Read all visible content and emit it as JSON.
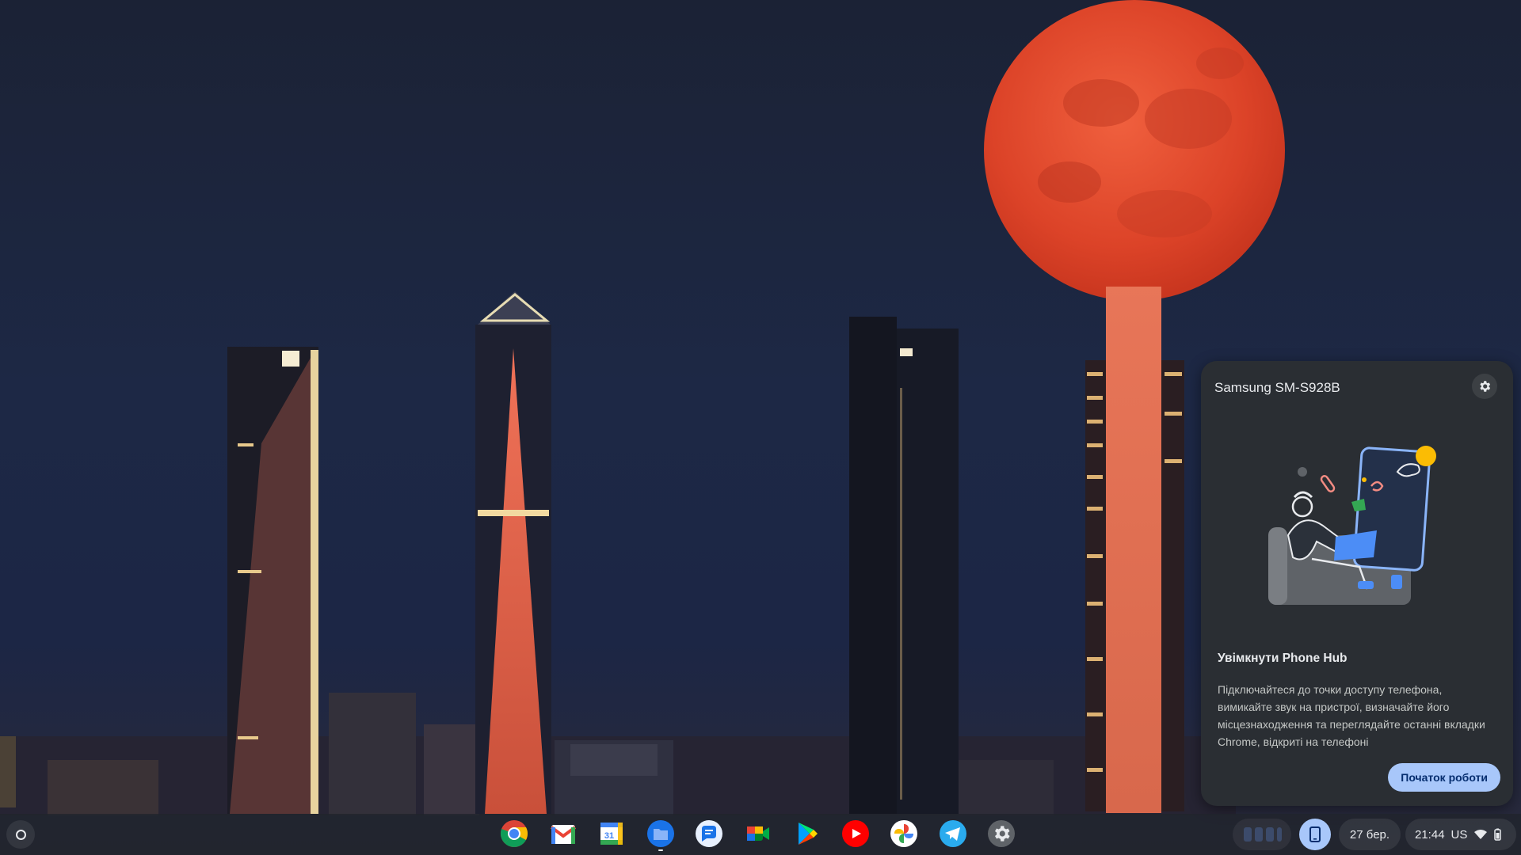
{
  "phone_hub": {
    "device_name": "Samsung SM-S928B",
    "heading": "Увімкнути Phone Hub",
    "description": "Підключайтеся до точки доступу телефона, вимикайте звук на пристрої, визначайте його місцезнаходження та переглядайте останні вкладки Chrome, відкриті на телефоні",
    "start_button": "Початок роботи",
    "settings_icon": "gear-icon"
  },
  "shelf": {
    "apps": [
      {
        "name": "Chrome",
        "icon": "chrome-icon"
      },
      {
        "name": "Gmail",
        "icon": "gmail-icon"
      },
      {
        "name": "Calendar",
        "icon": "calendar-icon",
        "label": "31"
      },
      {
        "name": "Files",
        "icon": "files-icon"
      },
      {
        "name": "Messages",
        "icon": "messages-icon"
      },
      {
        "name": "Google Meet",
        "icon": "meet-icon"
      },
      {
        "name": "Play Store",
        "icon": "play-store-icon"
      },
      {
        "name": "YouTube",
        "icon": "youtube-icon"
      },
      {
        "name": "Photos",
        "icon": "photos-icon"
      },
      {
        "name": "Telegram",
        "icon": "telegram-icon"
      },
      {
        "name": "Settings",
        "icon": "settings-icon"
      }
    ],
    "date": "27 бер.",
    "time": "21:44",
    "keyboard_layout": "US"
  },
  "colors": {
    "sky": "#1d2845",
    "moon": "#e0462f",
    "panel_bg": "#2a2e33",
    "accent": "#a8c7fa"
  }
}
